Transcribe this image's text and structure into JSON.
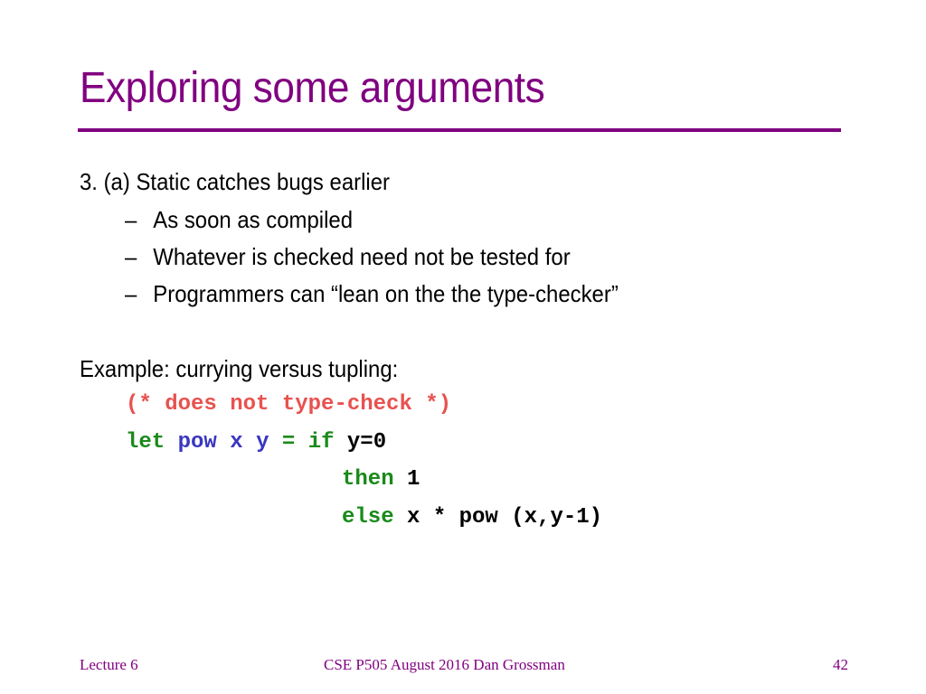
{
  "slide": {
    "title": "Exploring some arguments",
    "point": "3.  (a) Static catches bugs earlier",
    "bullets": [
      "As soon as compiled",
      "Whatever is checked need not be tested for",
      "Programmers can “lean on the the type-checker”"
    ],
    "bullet_marker": "–",
    "example_label": "Example: currying versus tupling:",
    "code": {
      "comment": "(* does not type-check *)",
      "line1": {
        "let": "let",
        "pow": "pow",
        "x": "x",
        "y": "y",
        "eq": "=",
        "if": "if",
        "cond": "y=0"
      },
      "line2": {
        "then": "then",
        "val": "1"
      },
      "line3": {
        "else": "else",
        "expr": "x * pow (x,y-1)"
      }
    },
    "colors": {
      "title": "#800080",
      "comment": "#e8524f",
      "keyword": "#1a8a1a",
      "identifier": "#3a37c0"
    }
  },
  "footer": {
    "left": "Lecture 6",
    "center": "CSE P505 August 2016  Dan Grossman",
    "page": "42"
  }
}
